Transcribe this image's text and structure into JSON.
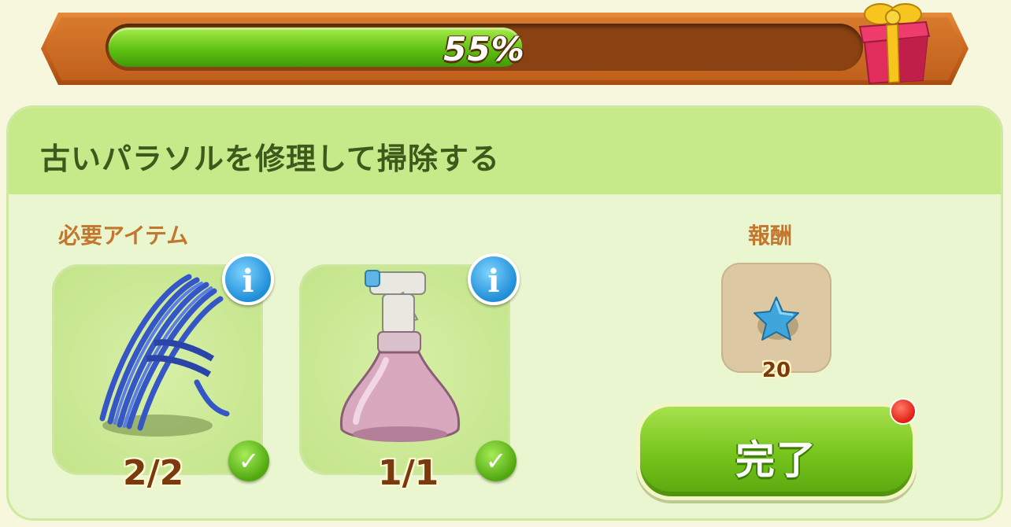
{
  "progress": {
    "percent_text": "55%",
    "value": 0.55
  },
  "gift": {
    "icon": "gift-box-icon"
  },
  "quest": {
    "title": "古いパラソルを修理して掃除する",
    "required_label": "必要アイテム",
    "reward_label": "報酬",
    "items": [
      {
        "name": "rope",
        "icon": "rope-icon",
        "count": "2/2",
        "complete": true
      },
      {
        "name": "spray bottle",
        "icon": "spray-bottle-icon",
        "count": "1/1",
        "complete": true
      }
    ],
    "reward": {
      "icon": "blue-star-icon",
      "count": "20"
    },
    "complete_button": "完了"
  },
  "colors": {
    "progress_fill": "#60c213",
    "panel_header": "#c6e98a",
    "button_green": "#75c41b",
    "notification": "#e01f10"
  }
}
